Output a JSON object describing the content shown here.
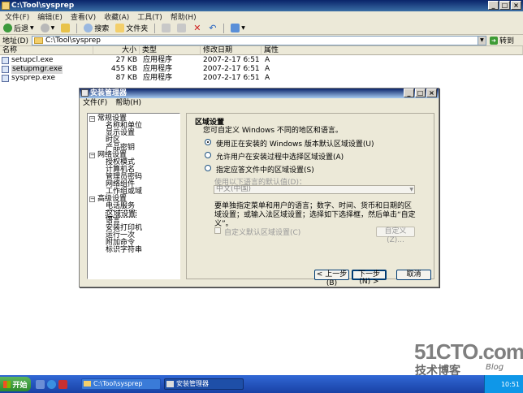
{
  "window": {
    "title": "C:\\Tool\\sysprep",
    "min": "_",
    "max": "□",
    "close": "×"
  },
  "menu": [
    "文件(F)",
    "编辑(E)",
    "查看(V)",
    "收藏(A)",
    "工具(T)",
    "帮助(H)"
  ],
  "toolbar": {
    "back": "后退",
    "search": "搜索",
    "folders": "文件夹"
  },
  "address": {
    "label": "地址(D)",
    "value": "C:\\Tool\\sysprep",
    "go": "转到"
  },
  "columns": {
    "name": "名称",
    "size": "大小",
    "type": "类型",
    "modified": "修改日期",
    "attr": "属性",
    "sort": "▲"
  },
  "files": [
    {
      "name": "setupcl.exe",
      "size": "27 KB",
      "type": "应用程序",
      "modified": "2007-2-17 6:51",
      "attr": "A"
    },
    {
      "name": "setupmgr.exe",
      "size": "455 KB",
      "type": "应用程序",
      "modified": "2007-2-17 6:51",
      "attr": "A"
    },
    {
      "name": "sysprep.exe",
      "size": "87 KB",
      "type": "应用程序",
      "modified": "2007-2-17 6:51",
      "attr": "A"
    }
  ],
  "dialog": {
    "title": "安装管理器",
    "menu": [
      "文件(F)",
      "帮助(H)"
    ],
    "min": "_",
    "max": "□",
    "close": "×",
    "tree": [
      {
        "label": "常规设置",
        "level": 0,
        "exp": "⊟"
      },
      {
        "label": "名称和单位",
        "level": 1
      },
      {
        "label": "显示设置",
        "level": 1
      },
      {
        "label": "时区",
        "level": 1
      },
      {
        "label": "产品密钥",
        "level": 1
      },
      {
        "label": "网络设置",
        "level": 0,
        "exp": "⊟"
      },
      {
        "label": "授权模式",
        "level": 1
      },
      {
        "label": "计算机名",
        "level": 1
      },
      {
        "label": "管理员密码",
        "level": 1
      },
      {
        "label": "网络组件",
        "level": 1
      },
      {
        "label": "工作组或域",
        "level": 1
      },
      {
        "label": "高级设置",
        "level": 0,
        "exp": "⊟"
      },
      {
        "label": "电话服务",
        "level": 1
      },
      {
        "label": "区域设置",
        "level": 1
      },
      {
        "label": "语言",
        "level": 1
      },
      {
        "label": "安装打印机",
        "level": 1
      },
      {
        "label": "运行一次",
        "level": 1
      },
      {
        "label": "附加命令",
        "level": 1
      },
      {
        "label": "标识字符串",
        "level": 1
      }
    ],
    "panel": {
      "heading": "区域设置",
      "subheading": "您可自定义 Windows 不同的地区和语言。",
      "options": [
        "使用正在安装的 Windows 版本默认区域设置(U)",
        "允许用户在安装过程中选择区域设置(A)",
        "指定应答文件中的区域设置(S)"
      ],
      "selected_option": 0,
      "lang_label": "使用以下语言的默认值(D)：",
      "lang_value": "中文(中国)",
      "note": "要单独指定菜单和用户的语言；数字、时间、货币和日期的区域设置；或输入法区域设置；选择如下选择框，然后单击“自定义”。",
      "custom_checkbox": "自定义默认区域设置(C)",
      "custom_button": "自定义(Z)..."
    },
    "buttons": {
      "back": "< 上一步(B)",
      "next": "下一步(N) >",
      "cancel": "取消"
    }
  },
  "taskbar": {
    "start": "开始",
    "tasks": [
      "C:\\Tool\\sysprep",
      "安装管理器"
    ],
    "time": "10:51"
  },
  "watermark": {
    "site": "51CTO.com",
    "line2": "技术博客",
    "blog": "Blog"
  }
}
